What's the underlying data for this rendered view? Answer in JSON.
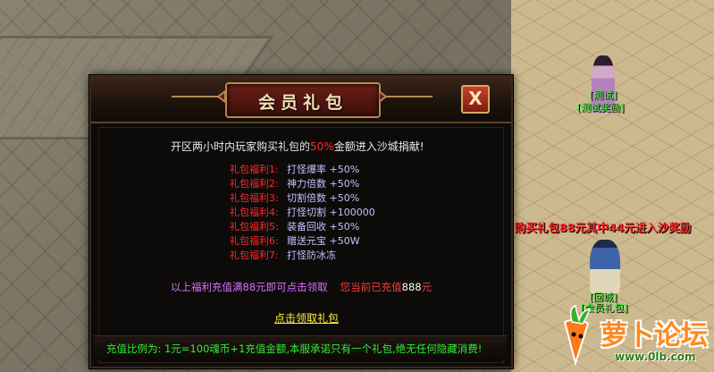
{
  "dialog": {
    "title": "会员礼包",
    "close_symbol": "X",
    "intro_before": "开区两小时内玩家购买礼包的",
    "intro_highlight": "50%",
    "intro_after": "金额进入沙城捐献!",
    "benefits": [
      {
        "label": "礼包福利1:",
        "value": "打怪爆率 +50%"
      },
      {
        "label": "礼包福利2:",
        "value": "神力倍数 +50%"
      },
      {
        "label": "礼包福利3:",
        "value": "切割倍数 +50%"
      },
      {
        "label": "礼包福利4:",
        "value": "打怪切割 +100000"
      },
      {
        "label": "礼包福利5:",
        "value": "装备回收 +50%"
      },
      {
        "label": "礼包福利6:",
        "value": "赠送元宝 +50W"
      },
      {
        "label": "礼包福利7:",
        "value": "打怪防冰冻"
      }
    ],
    "notice_left": "以上福利充值满88元即可点击领取",
    "notice_right_label": "您当前已充值",
    "notice_amount": "888",
    "notice_unit": "元",
    "claim_label": "点击领取礼包",
    "ratio_text": "充值比例为: 1元=100魂币+1充值金额,本服承诺只有一个礼包,绝无任何隐藏消费!"
  },
  "npcs": {
    "top": {
      "line1": "[测试]",
      "line2": "[测试奖励]"
    },
    "bottom": {
      "line1": "[回城]",
      "line2": "[会员礼包]"
    }
  },
  "promo_text": "购买礼包88元其中44元进入沙奖励",
  "watermark": {
    "name": "萝卜论坛",
    "url": "www.0lb.com"
  },
  "colors": {
    "benefit_label": "#ff2a2a",
    "benefit_value": "#c3c3ff",
    "claim": "#fff13a",
    "ratio": "#2fee2f"
  }
}
